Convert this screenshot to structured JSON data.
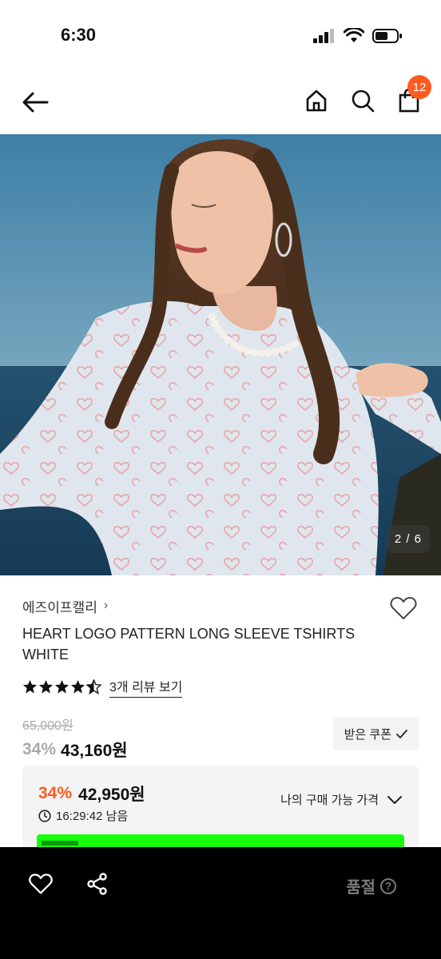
{
  "status_bar": {
    "time": "6:30"
  },
  "nav": {
    "cart_count": "12"
  },
  "product": {
    "image_counter": "2 / 6",
    "brand": "에즈이프캘리",
    "brand_chevron": "›",
    "title": "HEART LOGO PATTERN LONG SLEEVE TSHIRTS WHITE",
    "rating": 4.5,
    "review_link": "3개 리뷰 보기",
    "original_price": "65,000원",
    "discount": "34%",
    "price": "43,160원",
    "coupon_button": "받은 쿠폰"
  },
  "benefit": {
    "discount": "34%",
    "price": "42,950원",
    "timer": "16:29:42 남음",
    "dropdown_label": "나의 구매 가능 가격"
  },
  "bottom_bar": {
    "soldout_label": "품절",
    "help": "?"
  },
  "colors": {
    "accent": "#ff5a1f",
    "green_bar": "#16ff08",
    "bottom_bg": "#000000"
  }
}
